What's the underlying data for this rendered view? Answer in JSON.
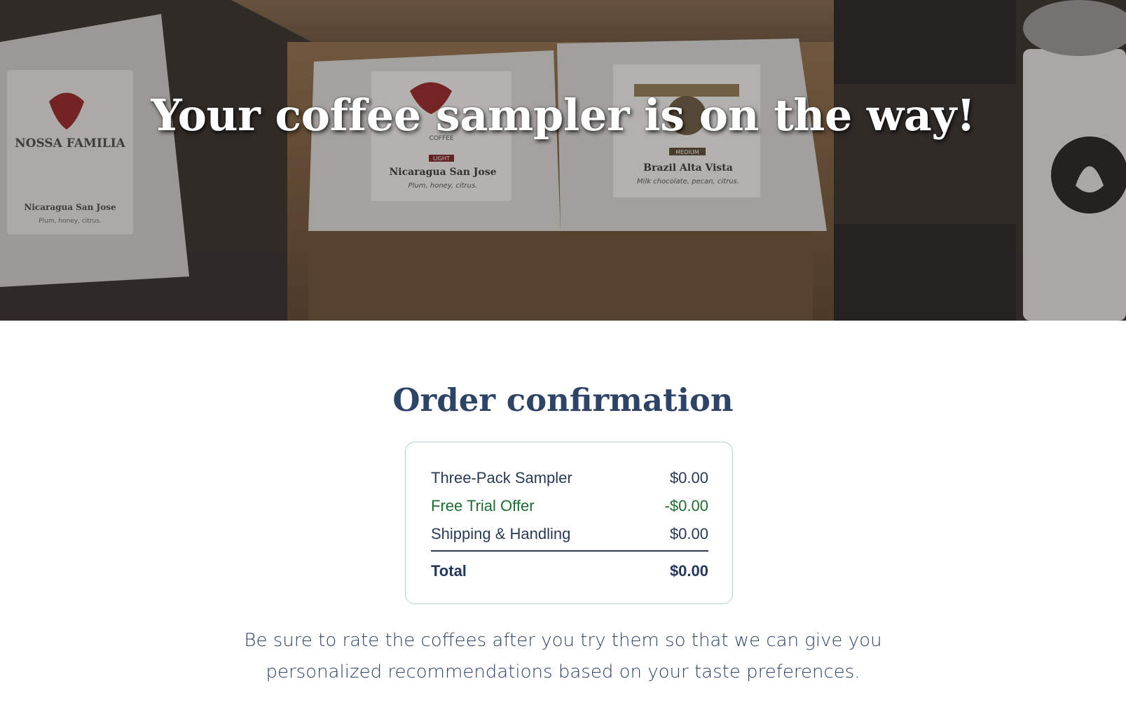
{
  "hero": {
    "title": "Your coffee sampler is on the way!",
    "bag_left": {
      "brand": "NOSSA FAMILIA",
      "coffee": "Nicaragua San Jose",
      "notes": "Plum, honey, citrus."
    },
    "bag_center": {
      "brand": "NOSSA FAMILIA",
      "sub": "COFFEE",
      "roast": "LIGHT",
      "coffee": "Nicaragua San Jose",
      "notes": "Plum, honey, citrus."
    },
    "bag_right": {
      "roast": "MEDIUM",
      "coffee": "Brazil Alta Vista",
      "notes": "Milk chocolate, pecan, citrus."
    }
  },
  "order": {
    "heading": "Order confirmation",
    "items": [
      {
        "label": "Three-Pack Sampler",
        "amount": "$0.00"
      },
      {
        "label": "Free Trial Offer",
        "amount": "-$0.00"
      },
      {
        "label": "Shipping & Handling",
        "amount": "$0.00"
      }
    ],
    "total_label": "Total",
    "total_amount": "$0.00"
  },
  "note": {
    "line1": "Be sure to rate the coffees after you try them so that we can give you",
    "line2": "personalized recommendations based on your taste preferences."
  },
  "colors": {
    "heading": "#2e4466",
    "discount": "#1e6b33",
    "card_border": "#a9d6cf"
  }
}
